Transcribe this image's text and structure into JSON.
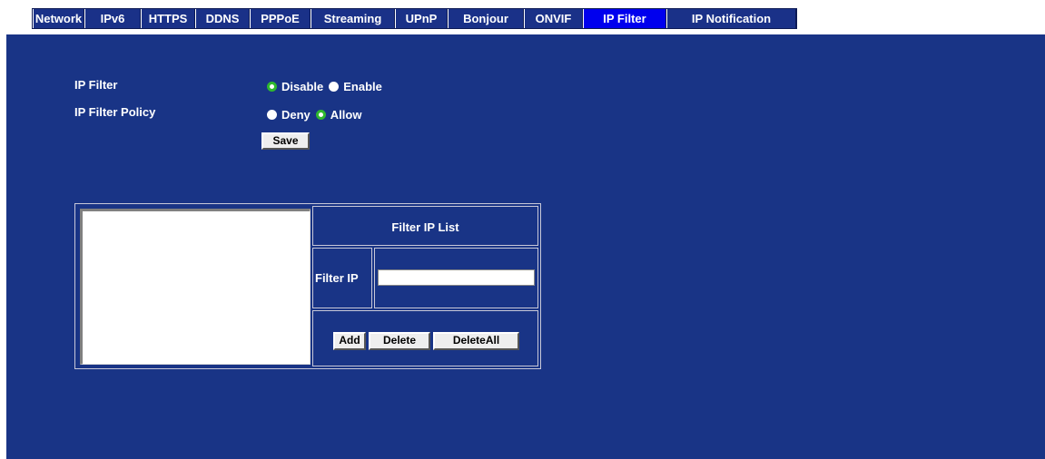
{
  "tabs": [
    {
      "label": "Network",
      "active": false
    },
    {
      "label": "IPv6",
      "active": false
    },
    {
      "label": "HTTPS",
      "active": false
    },
    {
      "label": "DDNS",
      "active": false
    },
    {
      "label": "PPPoE",
      "active": false
    },
    {
      "label": "Streaming",
      "active": false
    },
    {
      "label": "UPnP",
      "active": false
    },
    {
      "label": "Bonjour",
      "active": false
    },
    {
      "label": "ONVIF",
      "active": false
    },
    {
      "label": "IP Filter",
      "active": true
    },
    {
      "label": "IP Notification",
      "active": false
    }
  ],
  "settings": {
    "ip_filter_label": "IP Filter",
    "ip_filter_options": [
      "Disable",
      "Enable"
    ],
    "ip_filter_selected": "Disable",
    "policy_label": "IP Filter Policy",
    "policy_options": [
      "Deny",
      "Allow"
    ],
    "policy_selected": "Allow",
    "save_label": "Save"
  },
  "filter_table": {
    "header": "Filter IP List",
    "filter_ip_label": "Filter IP",
    "filter_ip_value": "",
    "list_items": [],
    "add_label": "Add",
    "delete_label": "Delete",
    "delete_all_label": "DeleteAll"
  },
  "colors": {
    "panel_bg": "#193486",
    "tab_bg": "#1a3188",
    "tab_active_bg": "#0000ee",
    "radio_checked": "#2fb82f"
  }
}
